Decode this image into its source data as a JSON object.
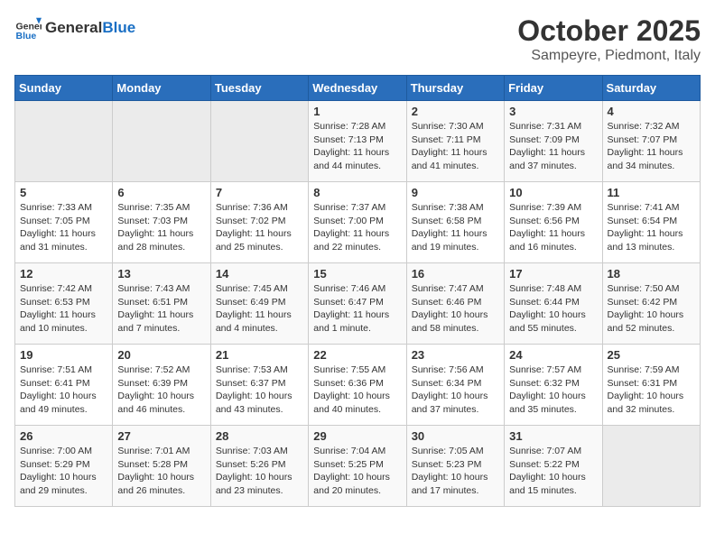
{
  "header": {
    "logo_general": "General",
    "logo_blue": "Blue",
    "month": "October 2025",
    "location": "Sampeyre, Piedmont, Italy"
  },
  "weekdays": [
    "Sunday",
    "Monday",
    "Tuesday",
    "Wednesday",
    "Thursday",
    "Friday",
    "Saturday"
  ],
  "weeks": [
    [
      {
        "day": "",
        "info": ""
      },
      {
        "day": "",
        "info": ""
      },
      {
        "day": "",
        "info": ""
      },
      {
        "day": "1",
        "info": "Sunrise: 7:28 AM\nSunset: 7:13 PM\nDaylight: 11 hours\nand 44 minutes."
      },
      {
        "day": "2",
        "info": "Sunrise: 7:30 AM\nSunset: 7:11 PM\nDaylight: 11 hours\nand 41 minutes."
      },
      {
        "day": "3",
        "info": "Sunrise: 7:31 AM\nSunset: 7:09 PM\nDaylight: 11 hours\nand 37 minutes."
      },
      {
        "day": "4",
        "info": "Sunrise: 7:32 AM\nSunset: 7:07 PM\nDaylight: 11 hours\nand 34 minutes."
      }
    ],
    [
      {
        "day": "5",
        "info": "Sunrise: 7:33 AM\nSunset: 7:05 PM\nDaylight: 11 hours\nand 31 minutes."
      },
      {
        "day": "6",
        "info": "Sunrise: 7:35 AM\nSunset: 7:03 PM\nDaylight: 11 hours\nand 28 minutes."
      },
      {
        "day": "7",
        "info": "Sunrise: 7:36 AM\nSunset: 7:02 PM\nDaylight: 11 hours\nand 25 minutes."
      },
      {
        "day": "8",
        "info": "Sunrise: 7:37 AM\nSunset: 7:00 PM\nDaylight: 11 hours\nand 22 minutes."
      },
      {
        "day": "9",
        "info": "Sunrise: 7:38 AM\nSunset: 6:58 PM\nDaylight: 11 hours\nand 19 minutes."
      },
      {
        "day": "10",
        "info": "Sunrise: 7:39 AM\nSunset: 6:56 PM\nDaylight: 11 hours\nand 16 minutes."
      },
      {
        "day": "11",
        "info": "Sunrise: 7:41 AM\nSunset: 6:54 PM\nDaylight: 11 hours\nand 13 minutes."
      }
    ],
    [
      {
        "day": "12",
        "info": "Sunrise: 7:42 AM\nSunset: 6:53 PM\nDaylight: 11 hours\nand 10 minutes."
      },
      {
        "day": "13",
        "info": "Sunrise: 7:43 AM\nSunset: 6:51 PM\nDaylight: 11 hours\nand 7 minutes."
      },
      {
        "day": "14",
        "info": "Sunrise: 7:45 AM\nSunset: 6:49 PM\nDaylight: 11 hours\nand 4 minutes."
      },
      {
        "day": "15",
        "info": "Sunrise: 7:46 AM\nSunset: 6:47 PM\nDaylight: 11 hours\nand 1 minute."
      },
      {
        "day": "16",
        "info": "Sunrise: 7:47 AM\nSunset: 6:46 PM\nDaylight: 10 hours\nand 58 minutes."
      },
      {
        "day": "17",
        "info": "Sunrise: 7:48 AM\nSunset: 6:44 PM\nDaylight: 10 hours\nand 55 minutes."
      },
      {
        "day": "18",
        "info": "Sunrise: 7:50 AM\nSunset: 6:42 PM\nDaylight: 10 hours\nand 52 minutes."
      }
    ],
    [
      {
        "day": "19",
        "info": "Sunrise: 7:51 AM\nSunset: 6:41 PM\nDaylight: 10 hours\nand 49 minutes."
      },
      {
        "day": "20",
        "info": "Sunrise: 7:52 AM\nSunset: 6:39 PM\nDaylight: 10 hours\nand 46 minutes."
      },
      {
        "day": "21",
        "info": "Sunrise: 7:53 AM\nSunset: 6:37 PM\nDaylight: 10 hours\nand 43 minutes."
      },
      {
        "day": "22",
        "info": "Sunrise: 7:55 AM\nSunset: 6:36 PM\nDaylight: 10 hours\nand 40 minutes."
      },
      {
        "day": "23",
        "info": "Sunrise: 7:56 AM\nSunset: 6:34 PM\nDaylight: 10 hours\nand 37 minutes."
      },
      {
        "day": "24",
        "info": "Sunrise: 7:57 AM\nSunset: 6:32 PM\nDaylight: 10 hours\nand 35 minutes."
      },
      {
        "day": "25",
        "info": "Sunrise: 7:59 AM\nSunset: 6:31 PM\nDaylight: 10 hours\nand 32 minutes."
      }
    ],
    [
      {
        "day": "26",
        "info": "Sunrise: 7:00 AM\nSunset: 5:29 PM\nDaylight: 10 hours\nand 29 minutes."
      },
      {
        "day": "27",
        "info": "Sunrise: 7:01 AM\nSunset: 5:28 PM\nDaylight: 10 hours\nand 26 minutes."
      },
      {
        "day": "28",
        "info": "Sunrise: 7:03 AM\nSunset: 5:26 PM\nDaylight: 10 hours\nand 23 minutes."
      },
      {
        "day": "29",
        "info": "Sunrise: 7:04 AM\nSunset: 5:25 PM\nDaylight: 10 hours\nand 20 minutes."
      },
      {
        "day": "30",
        "info": "Sunrise: 7:05 AM\nSunset: 5:23 PM\nDaylight: 10 hours\nand 17 minutes."
      },
      {
        "day": "31",
        "info": "Sunrise: 7:07 AM\nSunset: 5:22 PM\nDaylight: 10 hours\nand 15 minutes."
      },
      {
        "day": "",
        "info": ""
      }
    ]
  ]
}
